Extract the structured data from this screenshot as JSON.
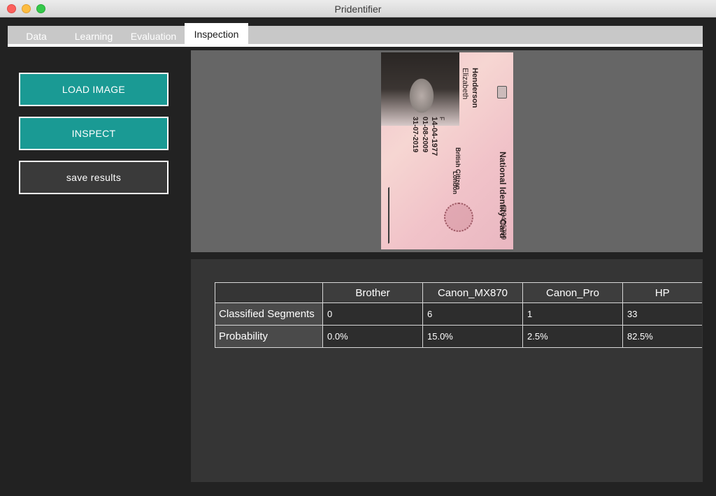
{
  "window": {
    "title": "Pridentifier"
  },
  "tabs": [
    {
      "label": "Data"
    },
    {
      "label": "Learning"
    },
    {
      "label": "Evaluation"
    },
    {
      "label": "Inspection",
      "active": true
    }
  ],
  "sidebar": {
    "load_label": "LOAD IMAGE",
    "inspect_label": "INSPECT",
    "save_label": "save results"
  },
  "card": {
    "surname": "Henderson",
    "given_name": "Elizabeth",
    "sex": "F",
    "dob": "14-04-1977",
    "issue_date": "01-08-2009",
    "expiry_date": "31-07-2019",
    "nationality": "British Citizen",
    "place": "London",
    "card_title": "National Identity Card",
    "number": "123456789"
  },
  "results": {
    "columns": [
      "Brother",
      "Canon_MX870",
      "Canon_Pro",
      "HP"
    ],
    "rows": [
      {
        "label": "Classified Segments",
        "values": [
          "0",
          "6",
          "1",
          "33"
        ]
      },
      {
        "label": "Probability",
        "values": [
          "0.0%",
          "15.0%",
          "2.5%",
          "82.5%"
        ]
      }
    ]
  },
  "colors": {
    "accent": "#1a9a94",
    "panel": "#666666",
    "background": "#222222"
  }
}
